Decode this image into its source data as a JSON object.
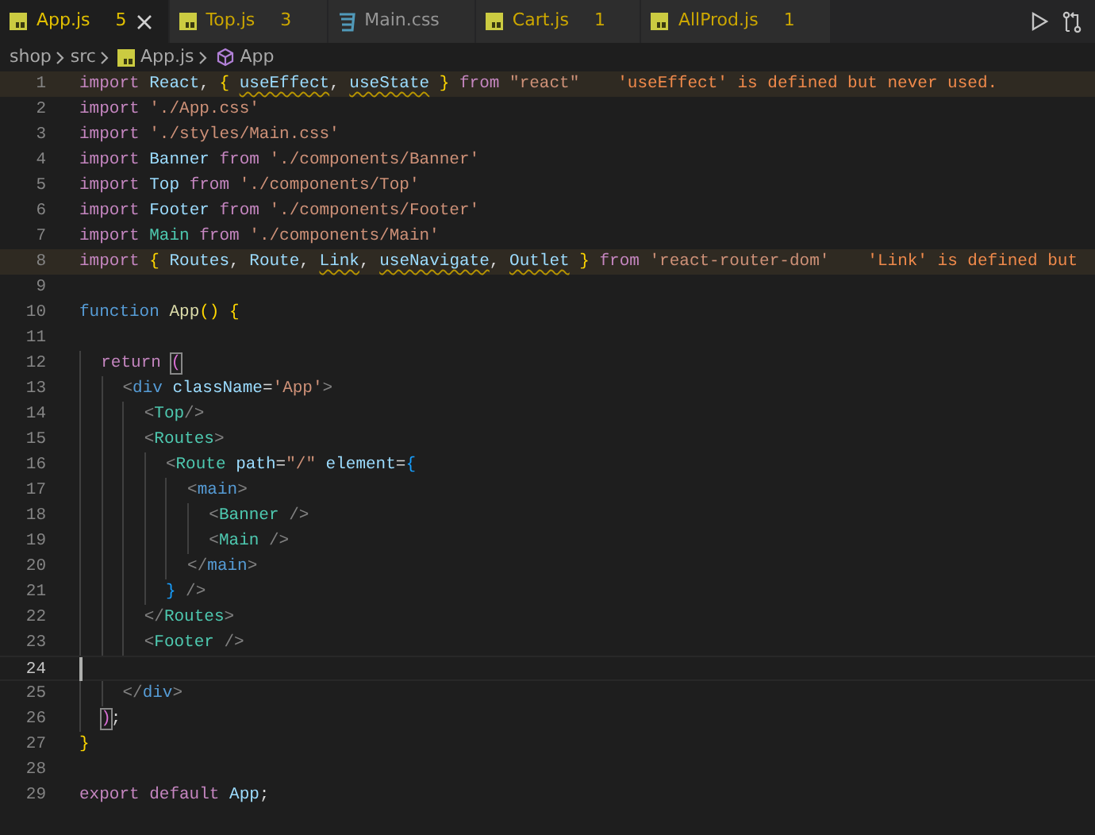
{
  "tabs": [
    {
      "label": "App.js",
      "kind": "js",
      "badge": "5",
      "warning": true,
      "selected": true
    },
    {
      "label": "Top.js",
      "kind": "js",
      "badge": "3",
      "warning": true,
      "selected": false
    },
    {
      "label": "Main.css",
      "kind": "css",
      "warning": false,
      "selected": false
    },
    {
      "label": "Cart.js",
      "kind": "js",
      "badge": "1",
      "warning": true,
      "selected": false
    },
    {
      "label": "AllProd.js",
      "kind": "js",
      "badge": "1",
      "warning": true,
      "selected": false
    }
  ],
  "breadcrumb": [
    {
      "label": "shop",
      "kind": "folder"
    },
    {
      "label": "src",
      "kind": "folder"
    },
    {
      "label": "App.js",
      "kind": "js"
    },
    {
      "label": "App",
      "kind": "symbol"
    }
  ],
  "editor": {
    "lines": [
      {
        "number": "1",
        "current": false,
        "tokens": [
          {
            "kind": "keyword",
            "text": "import "
          },
          {
            "kind": "var",
            "text": "React"
          },
          {
            "kind": "punct",
            "text": ", "
          },
          {
            "kind": "bracket1",
            "text": "{ "
          },
          {
            "kind": "unused",
            "text": "useEffect"
          },
          {
            "kind": "punct",
            "text": ", "
          },
          {
            "kind": "unused",
            "text": "useState"
          },
          {
            "kind": "bracket1",
            "text": " }"
          },
          {
            "kind": "keyword",
            "text": " from "
          },
          {
            "kind": "string",
            "text": "\"react\""
          }
        ],
        "diagnostic": "'useEffect' is defined but never used."
      },
      {
        "number": "2",
        "current": false,
        "tokens": [
          {
            "kind": "keyword",
            "text": "import "
          },
          {
            "kind": "string",
            "text": "'./App.css'"
          }
        ]
      },
      {
        "number": "3",
        "current": false,
        "tokens": [
          {
            "kind": "keyword",
            "text": "import "
          },
          {
            "kind": "string",
            "text": "'./styles/Main.css'"
          }
        ]
      },
      {
        "number": "4",
        "current": false,
        "tokens": [
          {
            "kind": "keyword",
            "text": "import "
          },
          {
            "kind": "var",
            "text": "Banner"
          },
          {
            "kind": "keyword",
            "text": " from "
          },
          {
            "kind": "string",
            "text": "'./components/Banner'"
          }
        ]
      },
      {
        "number": "5",
        "current": false,
        "tokens": [
          {
            "kind": "keyword",
            "text": "import "
          },
          {
            "kind": "var",
            "text": "Top"
          },
          {
            "kind": "keyword",
            "text": " from "
          },
          {
            "kind": "string",
            "text": "'./components/Top'"
          }
        ]
      },
      {
        "number": "6",
        "current": false,
        "tokens": [
          {
            "kind": "keyword",
            "text": "import "
          },
          {
            "kind": "var",
            "text": "Footer"
          },
          {
            "kind": "keyword",
            "text": " from "
          },
          {
            "kind": "string",
            "text": "'./components/Footer'"
          }
        ]
      },
      {
        "number": "7",
        "current": false,
        "tokens": [
          {
            "kind": "keyword",
            "text": "import "
          },
          {
            "kind": "class",
            "text": "Main"
          },
          {
            "kind": "keyword",
            "text": " from "
          },
          {
            "kind": "string",
            "text": "'./components/Main'"
          }
        ]
      },
      {
        "number": "8",
        "current": false,
        "tokens": [
          {
            "kind": "keyword",
            "text": "import "
          },
          {
            "kind": "bracket1",
            "text": "{ "
          },
          {
            "kind": "var",
            "text": "Routes"
          },
          {
            "kind": "punct",
            "text": ", "
          },
          {
            "kind": "var",
            "text": "Route"
          },
          {
            "kind": "punct",
            "text": ", "
          },
          {
            "kind": "unused",
            "text": "Link"
          },
          {
            "kind": "punct",
            "text": ", "
          },
          {
            "kind": "unused",
            "text": "useNavigate"
          },
          {
            "kind": "punct",
            "text": ", "
          },
          {
            "kind": "unused",
            "text": "Outlet"
          },
          {
            "kind": "bracket1",
            "text": " }"
          },
          {
            "kind": "keyword",
            "text": " from "
          },
          {
            "kind": "string",
            "text": "'react-router-dom'"
          }
        ],
        "diagnostic": "'Link' is defined but"
      },
      {
        "number": "9",
        "current": false
      },
      {
        "number": "10",
        "current": false,
        "tokens": [
          {
            "kind": "storage",
            "text": "function "
          },
          {
            "kind": "func",
            "text": "App"
          },
          {
            "kind": "bracket1",
            "text": "() {"
          }
        ]
      },
      {
        "number": "11",
        "current": false
      },
      {
        "number": "12",
        "current": false,
        "tokens": [
          {
            "kind": "keyword",
            "text": "  return "
          },
          {
            "kind": "bracket_match",
            "text": "("
          }
        ]
      },
      {
        "number": "13",
        "current": false,
        "tokens": [
          {
            "kind": "tag_punct",
            "text": "    <"
          },
          {
            "kind": "tag",
            "text": "div"
          },
          {
            "kind": "attr",
            "text": " className"
          },
          {
            "kind": "punct",
            "text": "="
          },
          {
            "kind": "string",
            "text": "'App'"
          },
          {
            "kind": "tag_punct",
            "text": ">"
          }
        ]
      },
      {
        "number": "14",
        "current": false,
        "tokens": [
          {
            "kind": "tag_punct",
            "text": "      <"
          },
          {
            "kind": "component",
            "text": "Top"
          },
          {
            "kind": "tag_punct",
            "text": "/>"
          }
        ]
      },
      {
        "number": "15",
        "current": false,
        "tokens": [
          {
            "kind": "tag_punct",
            "text": "      <"
          },
          {
            "kind": "component",
            "text": "Routes"
          },
          {
            "kind": "tag_punct",
            "text": ">"
          }
        ]
      },
      {
        "number": "16",
        "current": false,
        "tokens": [
          {
            "kind": "tag_punct",
            "text": "        <"
          },
          {
            "kind": "component",
            "text": "Route"
          },
          {
            "kind": "attr",
            "text": " path"
          },
          {
            "kind": "punct",
            "text": "="
          },
          {
            "kind": "string",
            "text": "\"/\""
          },
          {
            "kind": "attr",
            "text": " element"
          },
          {
            "kind": "punct",
            "text": "="
          },
          {
            "kind": "bracket3",
            "text": "{"
          }
        ]
      },
      {
        "number": "17",
        "current": false,
        "tokens": [
          {
            "kind": "tag_punct",
            "text": "          <"
          },
          {
            "kind": "tag",
            "text": "main"
          },
          {
            "kind": "tag_punct",
            "text": ">"
          }
        ]
      },
      {
        "number": "18",
        "current": false,
        "tokens": [
          {
            "kind": "tag_punct",
            "text": "            <"
          },
          {
            "kind": "component",
            "text": "Banner"
          },
          {
            "kind": "tag_punct",
            "text": " />"
          }
        ]
      },
      {
        "number": "19",
        "current": false,
        "tokens": [
          {
            "kind": "tag_punct",
            "text": "            <"
          },
          {
            "kind": "component",
            "text": "Main"
          },
          {
            "kind": "tag_punct",
            "text": " />"
          }
        ]
      },
      {
        "number": "20",
        "current": false,
        "tokens": [
          {
            "kind": "tag_punct",
            "text": "          </"
          },
          {
            "kind": "tag",
            "text": "main"
          },
          {
            "kind": "tag_punct",
            "text": ">"
          }
        ]
      },
      {
        "number": "21",
        "current": false,
        "tokens": [
          {
            "kind": "bracket3",
            "text": "        }"
          },
          {
            "kind": "tag_punct",
            "text": " />"
          }
        ]
      },
      {
        "number": "22",
        "current": false,
        "tokens": [
          {
            "kind": "tag_punct",
            "text": "      </"
          },
          {
            "kind": "component",
            "text": "Routes"
          },
          {
            "kind": "tag_punct",
            "text": ">"
          }
        ]
      },
      {
        "number": "23",
        "current": false,
        "tokens": [
          {
            "kind": "tag_punct",
            "text": "      <"
          },
          {
            "kind": "component",
            "text": "Footer"
          },
          {
            "kind": "tag_punct",
            "text": " />"
          }
        ]
      },
      {
        "number": "24",
        "current": true
      },
      {
        "number": "25",
        "current": false,
        "tokens": [
          {
            "kind": "tag_punct",
            "text": "    </"
          },
          {
            "kind": "tag",
            "text": "div"
          },
          {
            "kind": "tag_punct",
            "text": ">"
          }
        ]
      },
      {
        "number": "26",
        "current": false,
        "tokens": [
          {
            "kind": "bracket_match",
            "text": "  )"
          },
          {
            "kind": "punct",
            "text": ";"
          }
        ]
      },
      {
        "number": "27",
        "current": false,
        "tokens": [
          {
            "kind": "bracket1",
            "text": "}"
          }
        ]
      },
      {
        "number": "28",
        "current": false
      },
      {
        "number": "29",
        "current": false,
        "tokens": [
          {
            "kind": "keyword",
            "text": "export default "
          },
          {
            "kind": "var",
            "text": "App"
          },
          {
            "kind": "punct",
            "text": ";"
          }
        ]
      }
    ]
  }
}
